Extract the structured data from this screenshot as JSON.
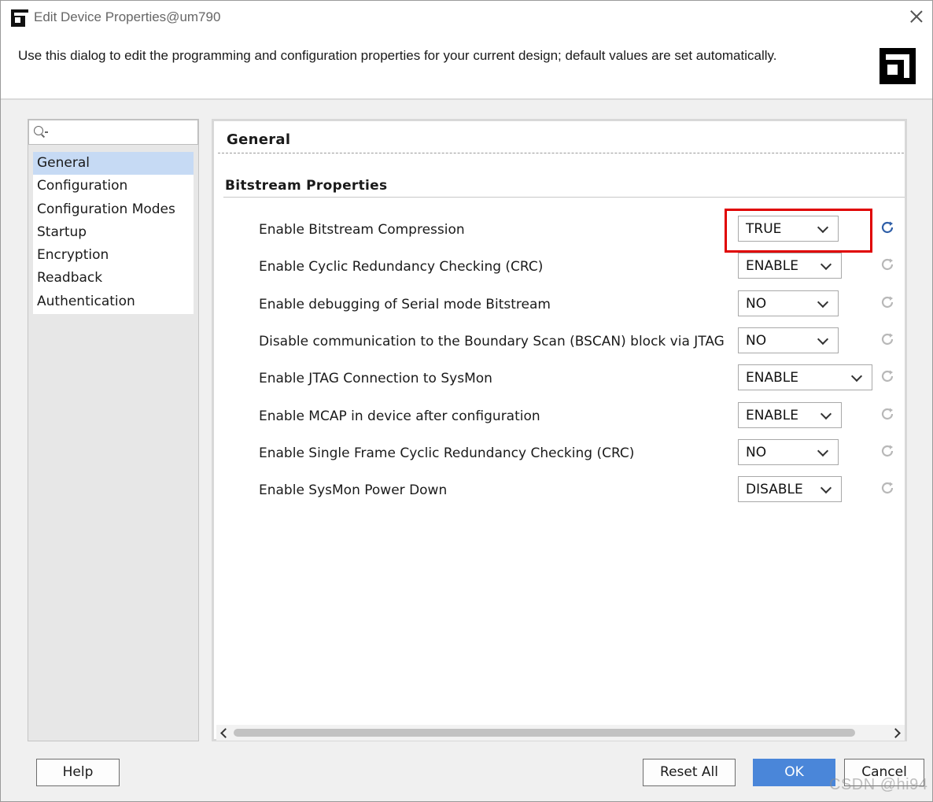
{
  "window": {
    "title": "Edit Device Properties@um790",
    "description": "Use this dialog to edit the programming and configuration properties for your current design; default values are set automatically."
  },
  "sidebar": {
    "search": {
      "value": "",
      "placeholder": ""
    },
    "items": [
      {
        "label": "General",
        "selected": true
      },
      {
        "label": "Configuration",
        "selected": false
      },
      {
        "label": "Configuration Modes",
        "selected": false
      },
      {
        "label": "Startup",
        "selected": false
      },
      {
        "label": "Encryption",
        "selected": false
      },
      {
        "label": "Readback",
        "selected": false
      },
      {
        "label": "Authentication",
        "selected": false
      }
    ]
  },
  "main": {
    "section_title": "General",
    "group_title": "Bitstream Properties",
    "properties": [
      {
        "label": "Enable Bitstream Compression",
        "value": "TRUE",
        "highlighted": true,
        "reset_active": true
      },
      {
        "label": "Enable Cyclic Redundancy Checking (CRC)",
        "value": "ENABLE",
        "highlighted": false,
        "reset_active": false
      },
      {
        "label": "Enable debugging of Serial mode Bitstream",
        "value": "NO",
        "highlighted": false,
        "reset_active": false
      },
      {
        "label": "Disable communication to the Boundary Scan (BSCAN) block via JTAG",
        "value": "NO",
        "highlighted": false,
        "reset_active": false
      },
      {
        "label": "Enable JTAG Connection to SysMon",
        "value": "ENABLE",
        "highlighted": false,
        "reset_active": false
      },
      {
        "label": "Enable MCAP in device after configuration",
        "value": "ENABLE",
        "highlighted": false,
        "reset_active": false
      },
      {
        "label": "Enable Single Frame Cyclic Redundancy Checking (CRC)",
        "value": "NO",
        "highlighted": false,
        "reset_active": false
      },
      {
        "label": "Enable SysMon Power Down",
        "value": "DISABLE",
        "highlighted": false,
        "reset_active": false
      }
    ]
  },
  "footer": {
    "help_label": "Help",
    "reset_all_label": "Reset All",
    "ok_label": "OK",
    "cancel_label": "Cancel"
  },
  "watermark": "CSDN @hi94",
  "colors": {
    "highlight": "#e00000",
    "selection": "#c6daf4",
    "primary_button": "#4a86d9",
    "reset_active": "#2f5fa8",
    "reset_inactive": "#b8b8b8"
  }
}
